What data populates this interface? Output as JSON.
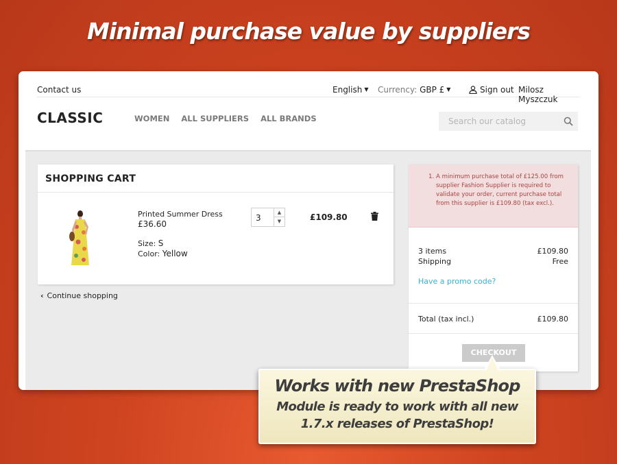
{
  "headline": "Minimal purchase value by suppliers",
  "topbar": {
    "contact": "Contact us",
    "language": "English",
    "currency_label": "Currency:",
    "currency_value": "GBP £",
    "signout": "Sign out",
    "username": "Milosz Myszczuk"
  },
  "header": {
    "logo": "CLASSIC",
    "nav": [
      "WOMEN",
      "ALL SUPPLIERS",
      "ALL BRANDS"
    ],
    "search_placeholder": "Search our catalog"
  },
  "cart": {
    "title": "SHOPPING CART",
    "item": {
      "name": "Printed Summer Dress",
      "price": "£36.60",
      "size_label": "Size:",
      "size_value": "S",
      "color_label": "Color:",
      "color_value": "Yellow",
      "quantity": "3",
      "total": "£109.80"
    },
    "continue": "Continue shopping"
  },
  "summary": {
    "alert_number": "1.",
    "alert_message": "A minimum purchase total of £125.00 from supplier Fashion Supplier is required to validate your order, current purchase total from this supplier is £109.80 (tax excl.).",
    "items_label": "3 items",
    "items_value": "£109.80",
    "shipping_label": "Shipping",
    "shipping_value": "Free",
    "promo": "Have a promo code?",
    "total_label": "Total (tax incl.)",
    "total_value": "£109.80",
    "checkout": "CHECKOUT"
  },
  "callout": {
    "title": "Works with new PrestaShop",
    "subtitle": "Module is ready to work with all new 1.7.x releases of PrestaShop!"
  }
}
